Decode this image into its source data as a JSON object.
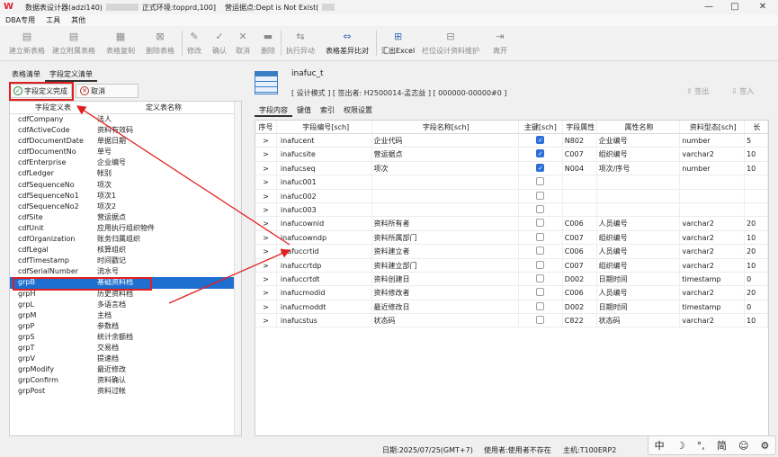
{
  "window": {
    "title_prefix": "数据表设计器(adzi140)",
    "title_env": "正式环境:topprd,100]",
    "title_site": "营运据点:Dept is Not Exist(",
    "minimize": "—",
    "maximize": "□",
    "close": "✕"
  },
  "menu": [
    "DBA专用",
    "工具",
    "其他"
  ],
  "toolbar": [
    {
      "label": "建立新表格",
      "icon": "new-table-icon",
      "glyph": "▤",
      "enabled": false
    },
    {
      "label": "建立附属表格",
      "icon": "sub-table-icon",
      "glyph": "▤",
      "enabled": false
    },
    {
      "label": "表格复制",
      "icon": "copy-table-icon",
      "glyph": "▦",
      "enabled": false
    },
    {
      "label": "删除表格",
      "icon": "delete-table-icon",
      "glyph": "⊠",
      "enabled": false
    },
    {
      "label": "修改",
      "icon": "edit-icon",
      "glyph": "✎",
      "enabled": false
    },
    {
      "label": "确认",
      "icon": "confirm-icon",
      "glyph": "✓",
      "enabled": false
    },
    {
      "label": "取消",
      "icon": "cancel-icon",
      "glyph": "✕",
      "enabled": false
    },
    {
      "label": "删除",
      "icon": "trash-icon",
      "glyph": "▬",
      "enabled": false
    },
    {
      "label": "执行异动",
      "icon": "execute-icon",
      "glyph": "⇆",
      "enabled": false
    },
    {
      "label": "表格差异比对",
      "icon": "compare-icon",
      "glyph": "⇔",
      "enabled": true
    },
    {
      "label": "汇出Excel",
      "icon": "excel-export-icon",
      "glyph": "⊞",
      "enabled": true
    },
    {
      "label": "栏位设计资料维护",
      "icon": "field-maintain-icon",
      "glyph": "⊟",
      "enabled": false
    },
    {
      "label": "离开",
      "icon": "exit-icon",
      "glyph": "⇥",
      "enabled": false
    }
  ],
  "left": {
    "tabs": [
      "表格清单",
      "字段定义清单"
    ],
    "active_tab": 1,
    "done_button": "字段定义完成",
    "cancel_button": "取消",
    "headers": [
      "字段定义表",
      "定义表名称"
    ],
    "rows": [
      [
        "cdfCompany",
        "法人"
      ],
      [
        "cdfActiveCode",
        "资料有效码"
      ],
      [
        "cdfDocumentDate",
        "单据日期"
      ],
      [
        "cdfDocumentNo",
        "单号"
      ],
      [
        "cdfEnterprise",
        "企业编号"
      ],
      [
        "cdfLedger",
        "帐别"
      ],
      [
        "cdfSequenceNo",
        "项次"
      ],
      [
        "cdfSequenceNo1",
        "项次1"
      ],
      [
        "cdfSequenceNo2",
        "项次2"
      ],
      [
        "cdfSite",
        "营运据点"
      ],
      [
        "cdfUnit",
        "应用执行组织物件"
      ],
      [
        "cdfOrganization",
        "账务归属组织"
      ],
      [
        "cdfLegal",
        "核算组织"
      ],
      [
        "cdfTimestamp",
        "时间戳记"
      ],
      [
        "cdfSerialNumber",
        "流水号"
      ],
      [
        "grpB",
        "基础资料档"
      ],
      [
        "grpH",
        "历史资料档"
      ],
      [
        "grpL",
        "多语言档"
      ],
      [
        "grpM",
        "主档"
      ],
      [
        "grpP",
        "参数档"
      ],
      [
        "grpS",
        "统计余额档"
      ],
      [
        "grpT",
        "交易档"
      ],
      [
        "grpV",
        "提速档"
      ],
      [
        "grpModify",
        "最近修改"
      ],
      [
        "grpConfirm",
        "资料确认"
      ],
      [
        "grpPost",
        "资料过帐"
      ]
    ],
    "selected_row": 15
  },
  "right": {
    "table_name": "inafuc_t",
    "info": "[ 设计模式 ] [ 签出者: H2500014-孟志益 ] [ 000000-00000#0 ]",
    "checkout_button": "签出",
    "checkin_button": "签入",
    "tabs": [
      "字段内容",
      "键值",
      "索引",
      "权限设置"
    ],
    "active_tab": 0,
    "headers": [
      "序号",
      "字段编号[sch]",
      "字段名称[sch]",
      "主键[sch]",
      "字段属性",
      "属性名称",
      "资料型态[sch]",
      "长"
    ],
    "rows": [
      {
        "arrow": ">",
        "code": "inafucent",
        "name": "企业代码",
        "pk": true,
        "attr": "N802",
        "attr_name": "企业编号",
        "type": "number",
        "len": "5"
      },
      {
        "arrow": ">",
        "code": "inafucsite",
        "name": "营运据点",
        "pk": true,
        "attr": "C007",
        "attr_name": "组织编号",
        "type": "varchar2",
        "len": "10"
      },
      {
        "arrow": ">",
        "code": "inafucseq",
        "name": "项次",
        "pk": true,
        "attr": "N004",
        "attr_name": "项次/序号",
        "type": "number",
        "len": "10"
      },
      {
        "arrow": ">",
        "code": "inafuc001",
        "name": "",
        "pk": false,
        "attr": "",
        "attr_name": "",
        "type": "",
        "len": ""
      },
      {
        "arrow": ">",
        "code": "inafuc002",
        "name": "",
        "pk": false,
        "attr": "",
        "attr_name": "",
        "type": "",
        "len": ""
      },
      {
        "arrow": ">",
        "code": "inafuc003",
        "name": "",
        "pk": false,
        "attr": "",
        "attr_name": "",
        "type": "",
        "len": ""
      },
      {
        "arrow": ">",
        "code": "inafucownid",
        "name": "资料所有者",
        "pk": false,
        "attr": "C006",
        "attr_name": "人员编号",
        "type": "varchar2",
        "len": "20"
      },
      {
        "arrow": ">",
        "code": "inafucowndp",
        "name": "资料所属部门",
        "pk": false,
        "attr": "C007",
        "attr_name": "组织编号",
        "type": "varchar2",
        "len": "10"
      },
      {
        "arrow": ">",
        "code": "inafuccrtid",
        "name": "资料建立者",
        "pk": false,
        "attr": "C006",
        "attr_name": "人员编号",
        "type": "varchar2",
        "len": "20"
      },
      {
        "arrow": ">",
        "code": "inafuccrtdp",
        "name": "资料建立部门",
        "pk": false,
        "attr": "C007",
        "attr_name": "组织编号",
        "type": "varchar2",
        "len": "10"
      },
      {
        "arrow": ">",
        "code": "inafuccrtdt",
        "name": "资料创建日",
        "pk": false,
        "attr": "D002",
        "attr_name": "日期时间",
        "type": "timestamp",
        "len": "0"
      },
      {
        "arrow": ">",
        "code": "inafucmodid",
        "name": "资料修改者",
        "pk": false,
        "attr": "C006",
        "attr_name": "人员编号",
        "type": "varchar2",
        "len": "20"
      },
      {
        "arrow": ">",
        "code": "inafucmoddt",
        "name": "最近修改日",
        "pk": false,
        "attr": "D002",
        "attr_name": "日期时间",
        "type": "timestamp",
        "len": "0"
      },
      {
        "arrow": ">",
        "code": "inafucstus",
        "name": "状态码",
        "pk": false,
        "attr": "C822",
        "attr_name": "状态码",
        "type": "varchar2",
        "len": "10"
      }
    ]
  },
  "status": {
    "date": "日期:2025/07/25(GMT+7)",
    "user": "使用者:使用者不存在",
    "host": "主机:T100ERP2"
  },
  "ime": [
    "中",
    "☽",
    "°,",
    "简",
    "☺",
    "⚙"
  ],
  "colors": {
    "selection": "#1f6fd0",
    "annotation": "#e02020",
    "checked": "#2d6fd6"
  }
}
